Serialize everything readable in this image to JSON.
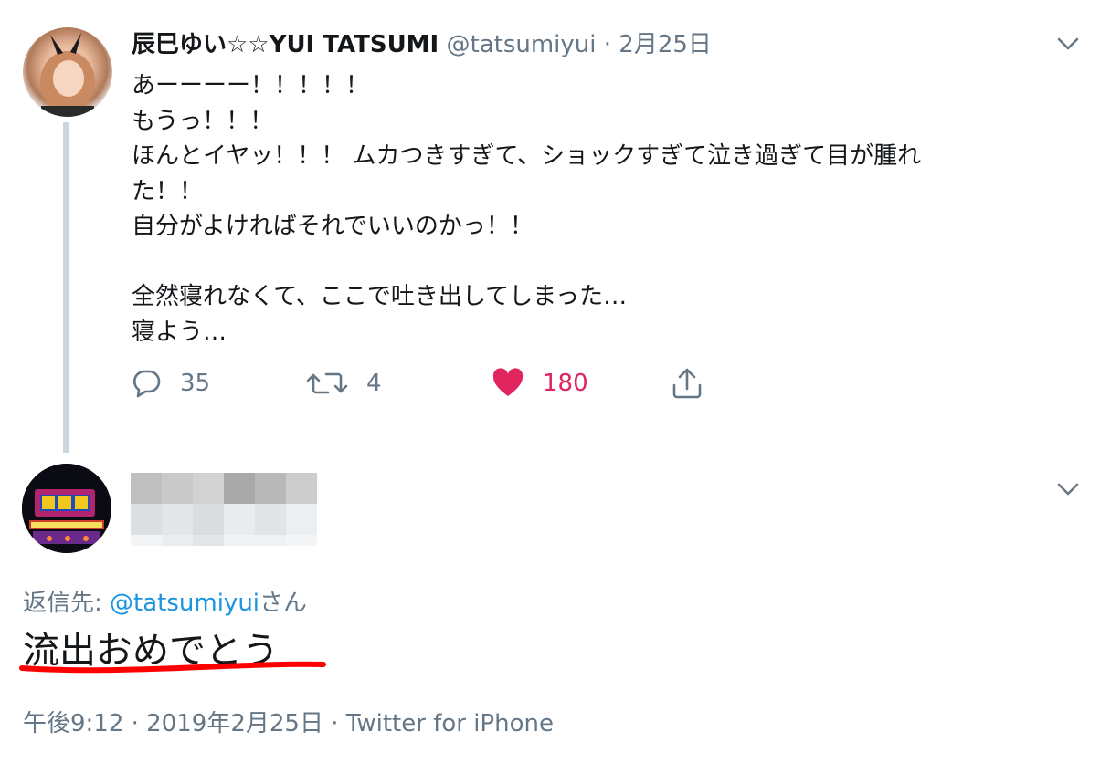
{
  "tweet1": {
    "display_name": "辰巳ゆい☆☆YUI TATSUMI",
    "handle": "@tatsumiyui",
    "separator": "·",
    "date": "2月25日",
    "lines": [
      "あーーーー！！！！！",
      "もうっ！！！",
      "ほんとイヤッ！！！ ムカつきすぎて、ショックすぎて泣き過ぎて目が腫れ",
      "た！！",
      "自分がよければそれでいいのかっ！！",
      "",
      "全然寝れなくて、ここで吐き出してしまった…",
      "寝よう…"
    ],
    "actions": {
      "reply_count": "35",
      "retweet_count": "4",
      "like_count": "180"
    }
  },
  "tweet2": {
    "reply_prefix": "返信先: ",
    "reply_handle": "@tatsumiyui",
    "reply_suffix": "さん",
    "text": "流出おめでとう",
    "timestamp": "午後9:12 · 2019年2月25日 · Twitter for iPhone"
  },
  "colors": {
    "text": "#14171a",
    "secondary": "#657786",
    "link": "#1b95e0",
    "like": "#e0245e",
    "underline": "#ff0000",
    "thread_line": "#ccd6dd"
  },
  "icons": {
    "reply": "speech-bubble-icon",
    "retweet": "retweet-arrows-icon",
    "like": "heart-icon",
    "share": "share-upload-icon",
    "menu": "chevron-down-icon"
  }
}
